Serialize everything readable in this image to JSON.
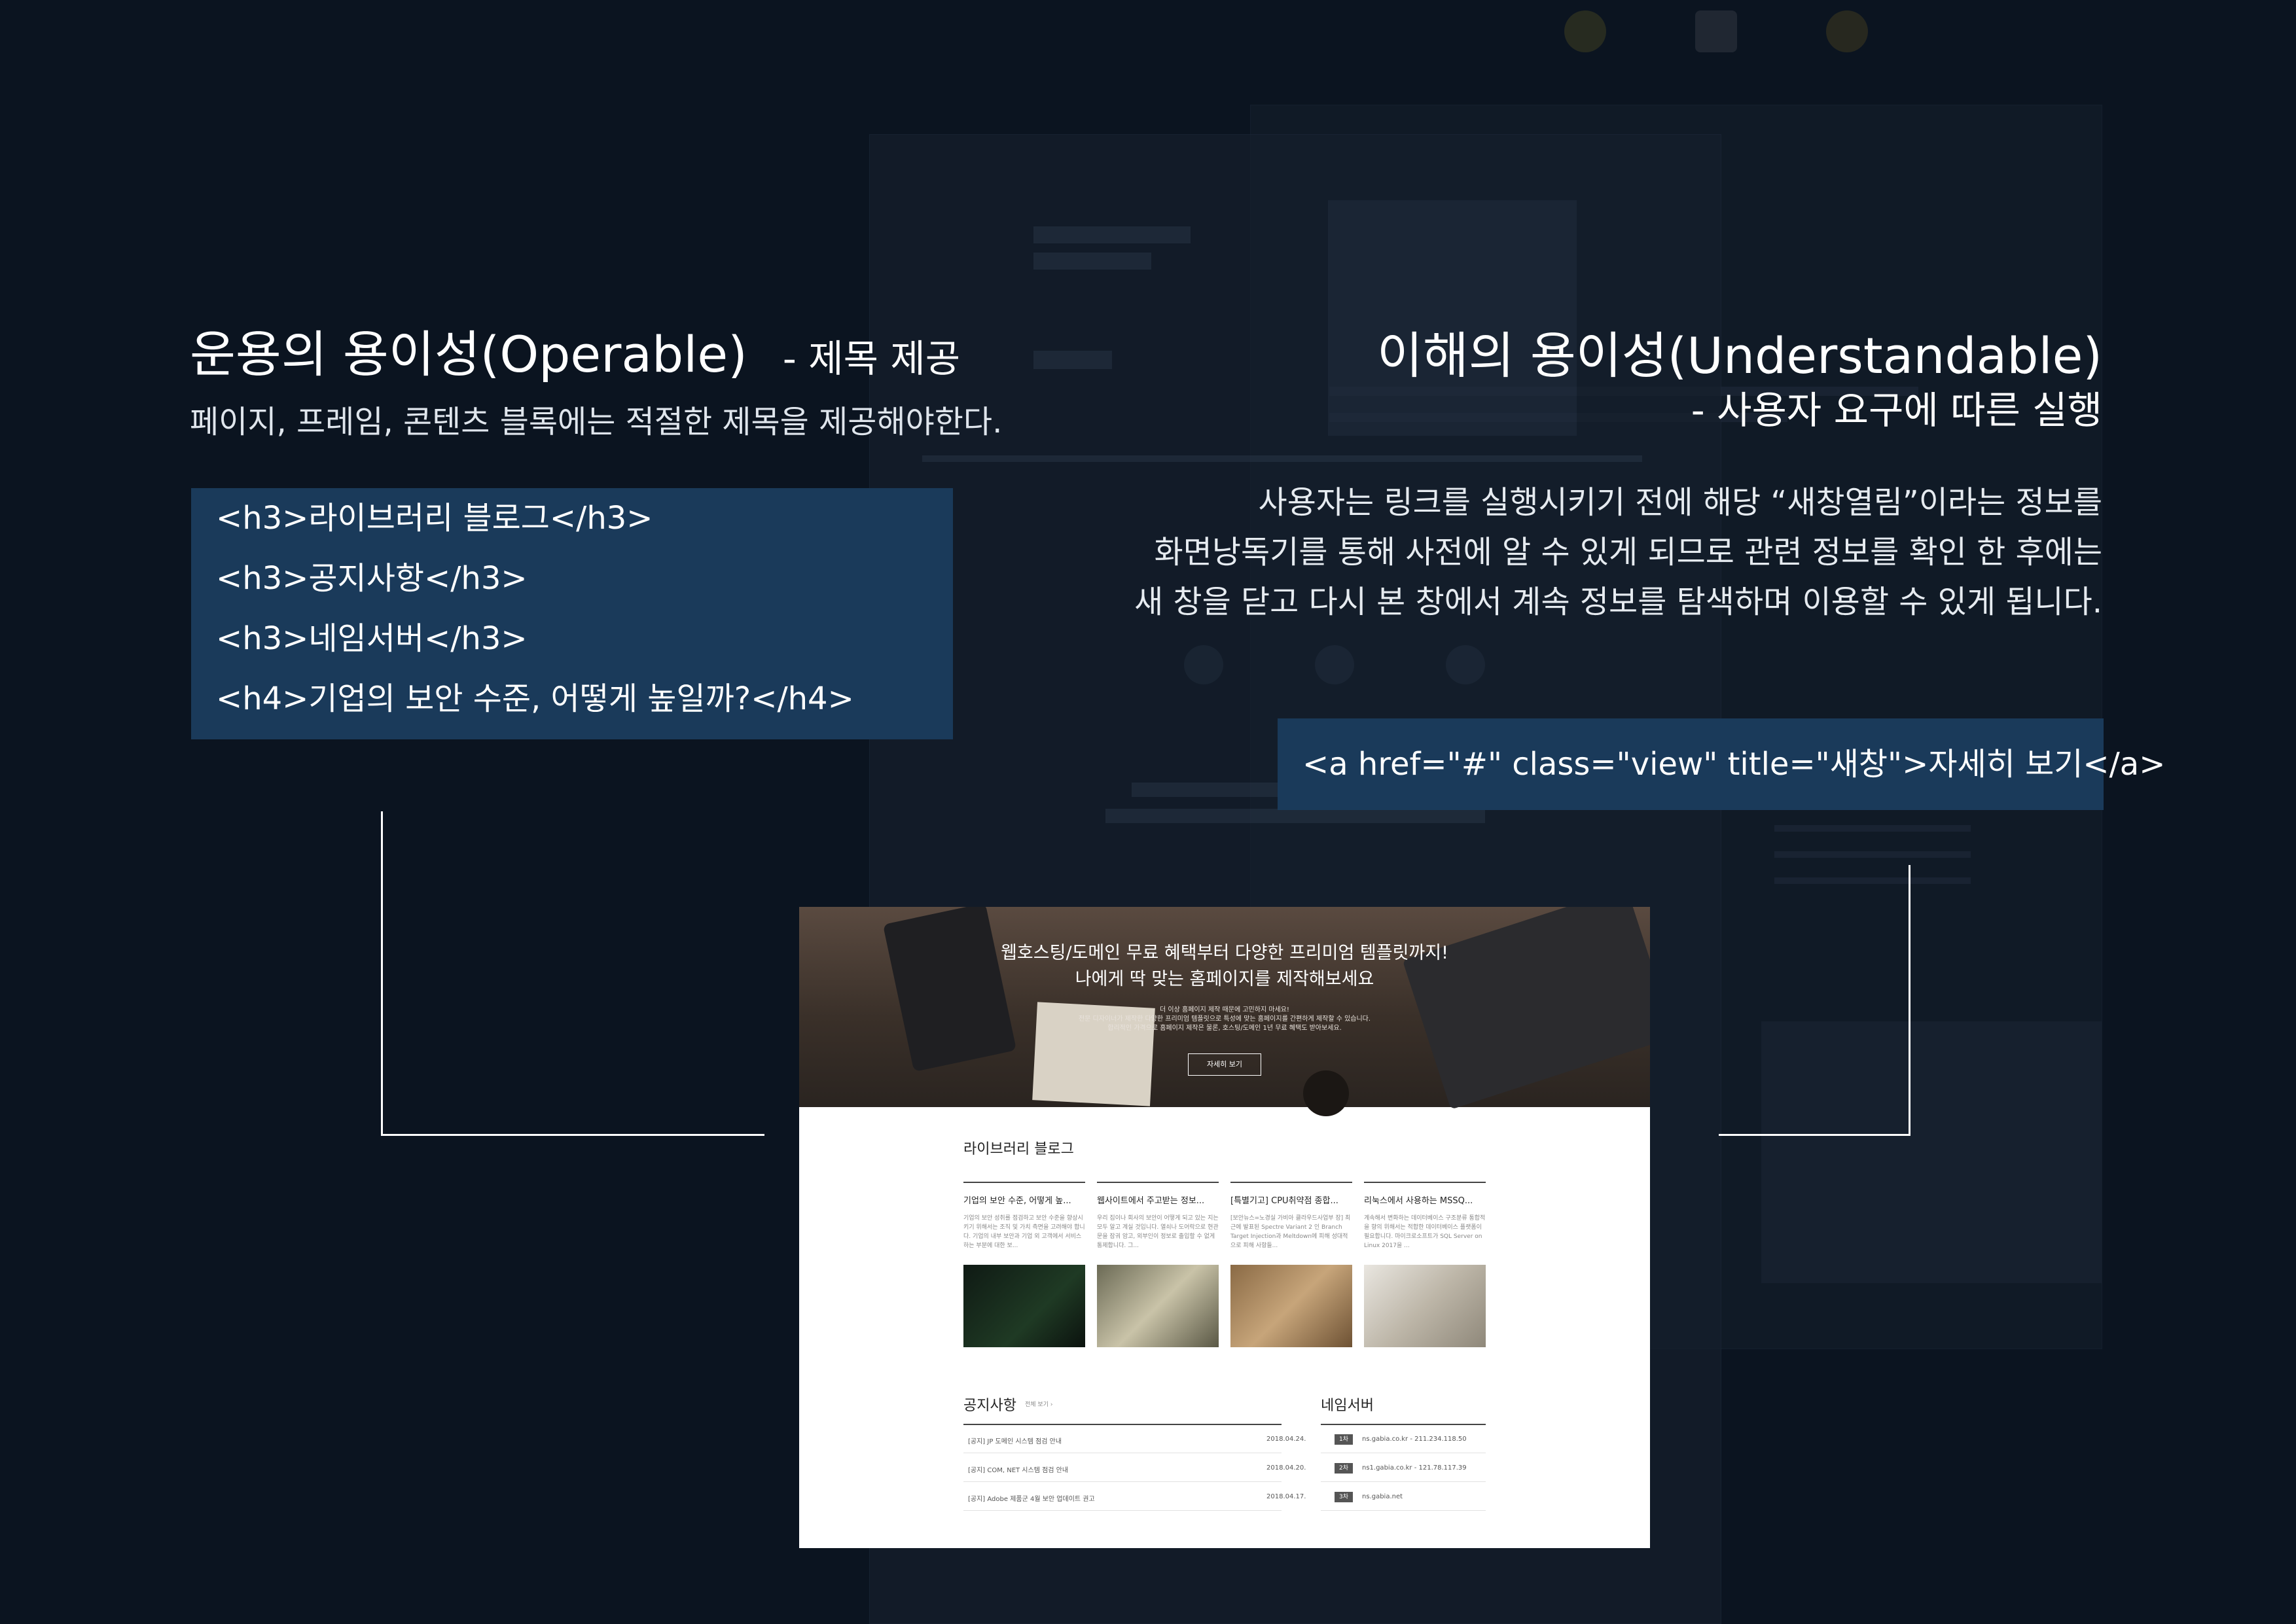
{
  "left_section": {
    "title": "운용의 용이성(Operable)",
    "subtitle": "- 제목 제공",
    "description": "페이지, 프레임, 콘텐츠 블록에는 적절한 제목을 제공해야한다.",
    "code_lines": [
      "<h3>라이브러리 블로그</h3>",
      "<h3>공지사항</h3>",
      "<h3>네임서버</h3>",
      "<h4>기업의 보안 수준, 어떻게 높일까?</h4>"
    ]
  },
  "right_section": {
    "title": "이해의 용이성(Understandable)",
    "subtitle": "- 사용자 요구에 따른 실행",
    "description_lines": [
      "사용자는 링크를 실행시키기 전에 해당 “새창열림”이라는 정보를",
      "화면낭독기를 통해 사전에 알 수 있게 되므로 관련 정보를 확인 한 후에는",
      "새 창을 닫고 다시 본 창에서 계속 정보를 탐색하며 이용할 수 있게 됩니다."
    ],
    "code": "<a href=\"#\" class=\"view\" title=\"새창\">자세히 보기</a>"
  },
  "screenshot": {
    "hero": {
      "title_line1": "웹호스팅/도메인 무료 혜택부터 다양한 프리미엄 템플릿까지!",
      "title_line2": "나에게 딱 맞는 홈페이지를 제작해보세요",
      "sub_lines": [
        "더 이상 홈페이지 제작 때문에 고민하지 마세요!",
        "전문 디자이너가 제작한 다양한 프리미엄 템플릿으로 특성에 맞는 홈페이지를 간편하게 제작할 수 있습니다.",
        "합리적인 가격으로 홈페이지 제작은 물론, 호스팅/도메인 1년 무료 혜택도 받아보세요."
      ],
      "button": "자세히 보기"
    },
    "library": {
      "title": "라이브러리 블로그",
      "posts": [
        {
          "title": "기업의 보안 수준, 어떻게 높...",
          "body": "기업의 보안 성취를 점검하고 보안 수준을 향상시키기 위해서는 조직 및 가치 측면을 고려해야 합니다. 기업의 내부 보안과 기업 외 고객에서 서비스하는 부분에 대한 보..."
        },
        {
          "title": "웹사이트에서 주고받는 정보...",
          "body": "우리 집이나 회사의 보안이 어떻게 되고 있는 지는 모두 알고 계실 것입니다. 열쇠나 도어락으로 현관문을 잠궈 암고, 외부인이 정보로 출입할 수 없게 통제합니다. 그..."
        },
        {
          "title": "[특별기고] CPU취약점 종합...",
          "body": "[보안뉴스=노경실 가비아 클라우드사업부 장] 최근에 발표된 Spectre Variant 2 인 Branch Target Injection과 Meltdown에 피해 성대적으로 피해 사항들..."
        },
        {
          "title": "리눅스에서 사용하는 MSSQ...",
          "body": "계속해서 변화하는 데이터베이스 구조분류 통합적을 향의 위해서는 적합한 데이터베이스 플랫폼이 필요합니다. 마이크로소프트가 SQL Server on Linux 2017을 ..."
        }
      ]
    },
    "notice": {
      "title": "공지사항",
      "more": "전체 보기 ›",
      "rows": [
        {
          "text": "[공지] JP 도메인 시스템 점검 안내",
          "date": "2018.04.24."
        },
        {
          "text": "[공지] COM, NET 시스템 점검 안내",
          "date": "2018.04.20."
        },
        {
          "text": "[공지] Adobe 제품군 4월 보안 업데이트 권고",
          "date": "2018.04.17."
        }
      ]
    },
    "nameserver": {
      "title": "네임서버",
      "rows": [
        {
          "badge": "1차",
          "text": "ns.gabia.co.kr - 211.234.118.50"
        },
        {
          "badge": "2차",
          "text": "ns1.gabia.co.kr - 121.78.117.39"
        },
        {
          "badge": "3차",
          "text": "ns.gabia.net"
        }
      ]
    }
  },
  "colors": {
    "background": "#0b1420",
    "code_box": "#1a3a5a",
    "text": "#ffffff"
  }
}
